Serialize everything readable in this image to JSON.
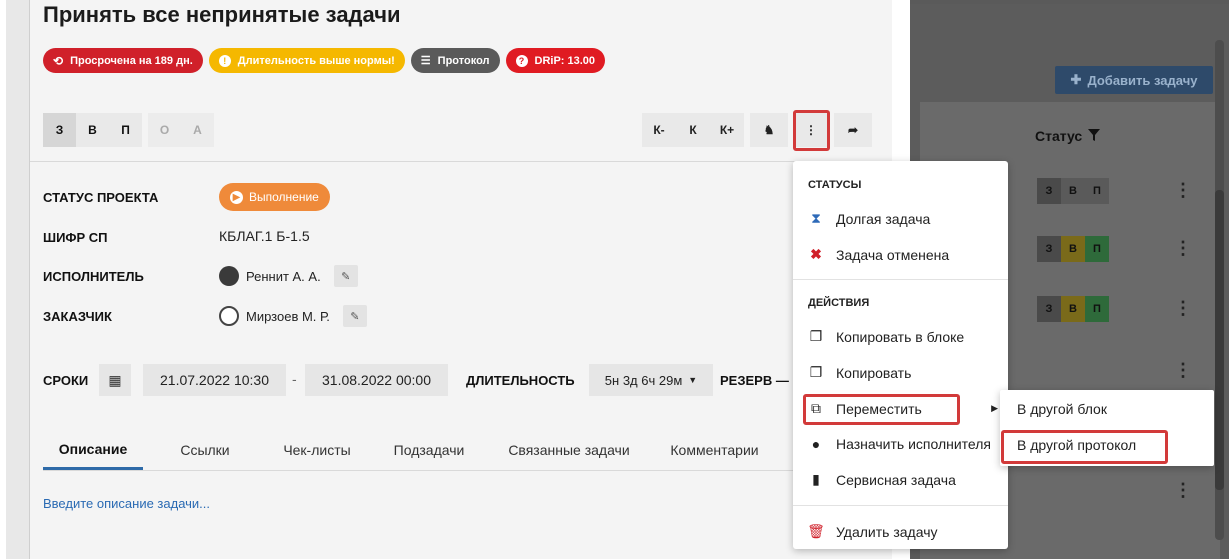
{
  "task": {
    "title": "Принять все непринятые задачи",
    "badges": [
      {
        "label": "Просрочена на 189 дн.",
        "icon": "history-icon",
        "color": "#d0202a"
      },
      {
        "label": "Длительность выше нормы!",
        "icon": "alert-icon",
        "color": "#f5b800"
      },
      {
        "label": "Протокол",
        "icon": "list-icon",
        "color": "#5a5a5a"
      },
      {
        "label": "DRiP: 13.00",
        "icon": "help-icon",
        "color": "#e01b22"
      }
    ],
    "priority_buttons": [
      "З",
      "В",
      "П",
      "О",
      "А"
    ],
    "tool_buttons": [
      "К-",
      "К",
      "К+"
    ],
    "fields": {
      "project_status_label": "СТАТУС ПРОЕКТА",
      "project_status_value": "Выполнение",
      "cipher_label": "ШИФР СП",
      "cipher_value": "КБЛАГ.1 Б-1.5",
      "executor_label": "ИСПОЛНИТЕЛЬ",
      "executor_value": "Реннит А. А.",
      "customer_label": "ЗАКАЗЧИК",
      "customer_value": "Мирзоев М. Р."
    },
    "dates": {
      "label": "СРОКИ",
      "start": "21.07.2022  10:30",
      "separator": "-",
      "end": "31.08.2022  00:00",
      "duration_label": "ДЛИТЕЛЬНОСТЬ",
      "duration_value": "5н 3д 6ч 29м",
      "reserve_label": "РЕЗЕРВ —"
    },
    "tabs": [
      "Описание",
      "Ссылки",
      "Чек-листы",
      "Подзадачи",
      "Связанные задачи",
      "Комментарии"
    ],
    "description_placeholder": "Введите описание задачи..."
  },
  "menu": {
    "statuses_header": "СТАТУСЫ",
    "status_items": [
      {
        "label": "Долгая задача",
        "icon": "hourglass-icon",
        "color": "#2e6ab8"
      },
      {
        "label": "Задача отменена",
        "icon": "cross-icon",
        "color": "#d0202a"
      }
    ],
    "actions_header": "ДЕЙСТВИЯ",
    "action_items": [
      {
        "label": "Копировать в блоке",
        "icon": "copy-icon"
      },
      {
        "label": "Копировать",
        "icon": "copy-icon"
      },
      {
        "label": "Переместить",
        "icon": "move-icon"
      },
      {
        "label": "Назначить исполнителя",
        "icon": "user-icon"
      },
      {
        "label": "Сервисная задача",
        "icon": "chip-icon"
      }
    ],
    "delete_item": {
      "label": "Удалить задачу",
      "icon": "trash-icon",
      "color": "#d0202a"
    }
  },
  "submenu": {
    "items": [
      "В другой блок",
      "В другой протокол"
    ]
  },
  "background": {
    "add_task": "Добавить задачу",
    "status_header": "Статус",
    "row_letters": [
      "З",
      "В",
      "П"
    ]
  }
}
